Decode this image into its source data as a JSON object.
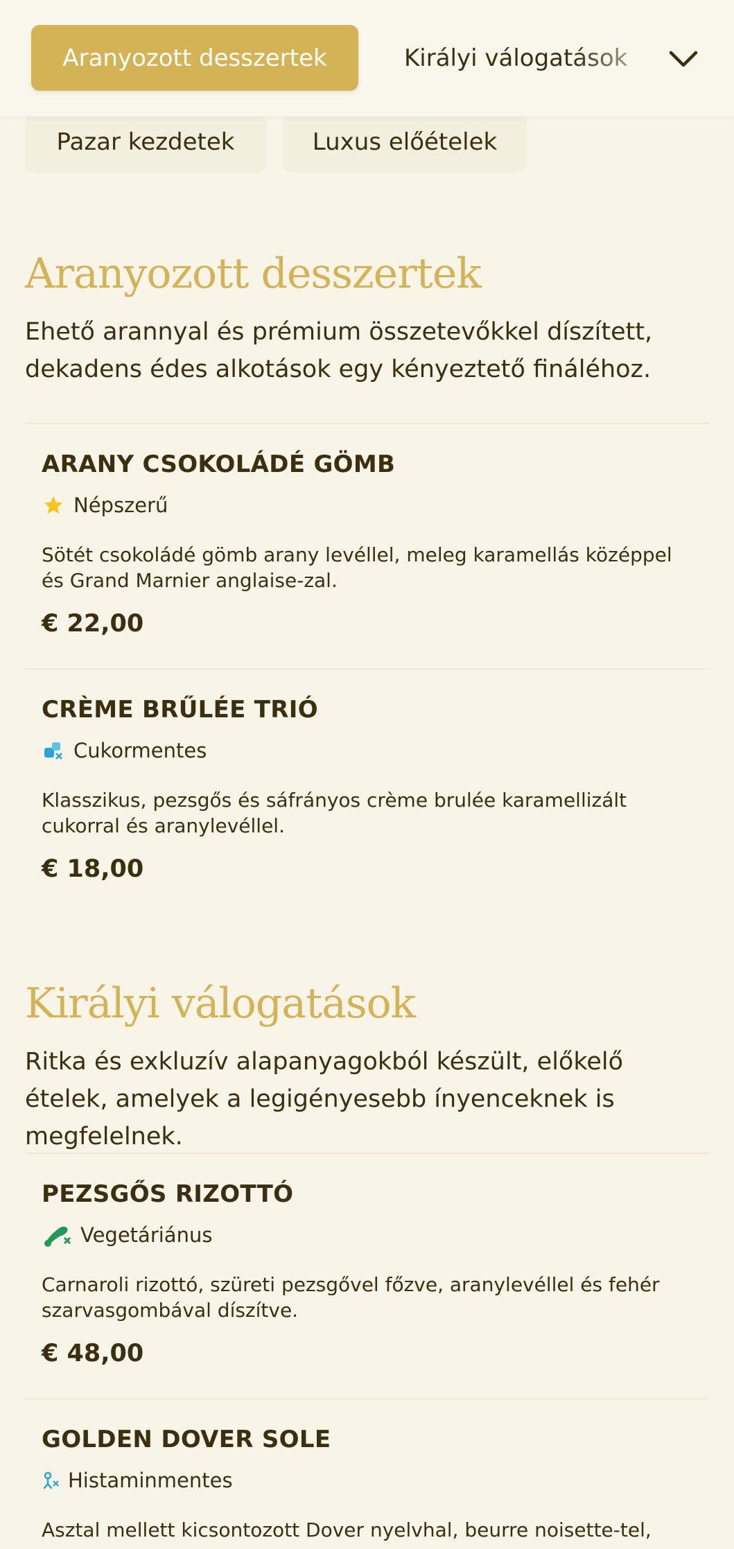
{
  "category_nav": {
    "active_tab": "Aranyozott desszertek",
    "next_tab": "Királyi válogatások",
    "expand_icon": "chevron-down-icon",
    "pills": [
      "Pazar kezdetek",
      "Luxus előételek"
    ]
  },
  "colors": {
    "accent": "#d4b357",
    "background": "#f8f4e8",
    "text": "#3b2f12"
  },
  "sections": [
    {
      "title": "Aranyozott desszertek",
      "description": "Ehető arannyal és prémium összetevőkkel díszített, dekadens édes alkotások egy kényeztető fináléhoz.",
      "items": [
        {
          "name": "ARANY CSOKOLÁDÉ GÖMB",
          "tag": "Népszerű",
          "tag_icon": "star-icon",
          "description": "Sötét csokoládé gömb arany levéllel, meleg karamellás középpel és Grand Marnier anglaise-zal.",
          "price": "€ 22,00"
        },
        {
          "name": "CRÈME BRŰLÉE TRIÓ",
          "tag": "Cukormentes",
          "tag_icon": "sugar-free-icon",
          "description": "Klasszikus, pezsgős és sáfrányos crème brulée karamellizált cukorral és aranylevéllel.",
          "price": "€ 18,00"
        }
      ]
    },
    {
      "title": "Királyi válogatások",
      "description": "Ritka és exkluzív alapanyagokból készült, előkelő ételek, amelyek a legigényesebb ínyenceknek is megfelelnek.",
      "items": [
        {
          "name": "PEZSGŐS RIZOTTÓ",
          "tag": "Vegetáriánus",
          "tag_icon": "vegetarian-icon",
          "description": "Carnaroli rizottó, szüreti pezsgővel főzve, aranylevéllel és fehér szarvasgombával díszítve.",
          "price": "€ 48,00"
        },
        {
          "name": "GOLDEN DOVER SOLE",
          "tag": "Histaminmentes",
          "tag_icon": "histamine-free-icon",
          "description": "Asztal mellett kicsontozott Dover nyelvhal, beurre noisette-tel,"
        }
      ]
    }
  ]
}
